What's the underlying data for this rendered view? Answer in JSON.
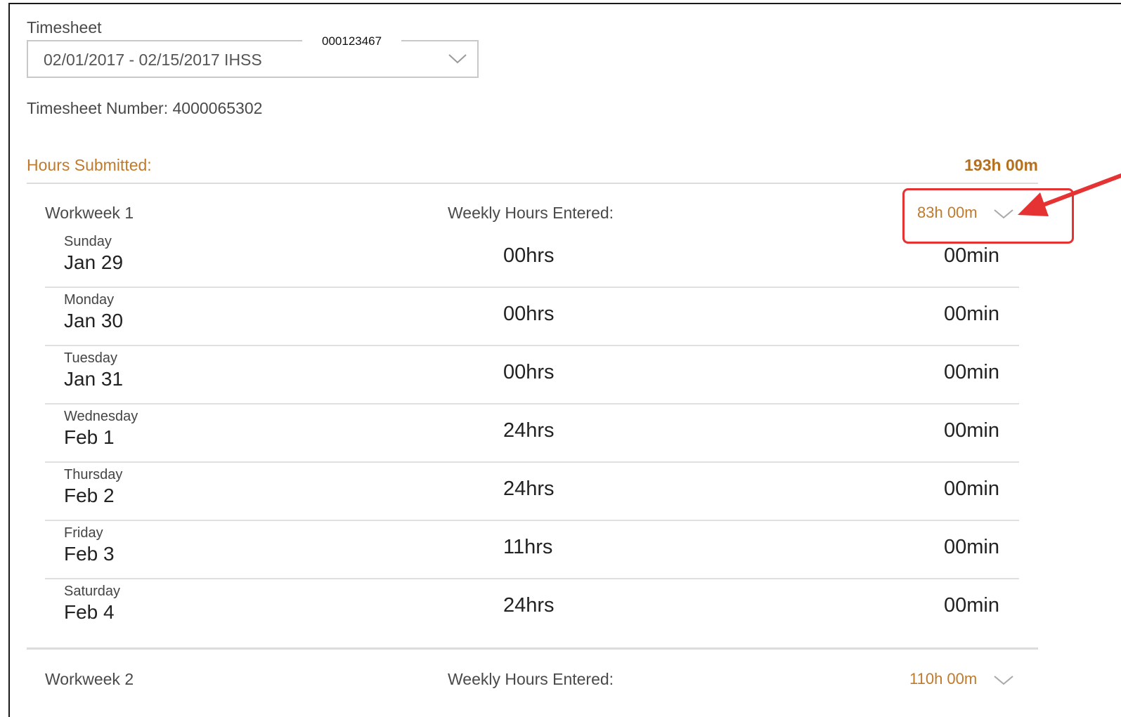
{
  "timesheet": {
    "label": "Timesheet",
    "selected": "02/01/2017 - 02/15/2017 IHSS",
    "id_tag": "000123467",
    "number_text": "Timesheet Number: 4000065302"
  },
  "hours_submitted": {
    "label": "Hours Submitted:",
    "value": "193h 00m"
  },
  "workweek1": {
    "label": "Workweek 1",
    "weekly_label": "Weekly Hours Entered:",
    "total": "83h 00m",
    "days": [
      {
        "day": "Sunday",
        "date": "Jan 29",
        "hrs": "00hrs",
        "min": "00min"
      },
      {
        "day": "Monday",
        "date": "Jan 30",
        "hrs": "00hrs",
        "min": "00min"
      },
      {
        "day": "Tuesday",
        "date": "Jan 31",
        "hrs": "00hrs",
        "min": "00min"
      },
      {
        "day": "Wednesday",
        "date": "Feb 1",
        "hrs": "24hrs",
        "min": "00min"
      },
      {
        "day": "Thursday",
        "date": "Feb 2",
        "hrs": "24hrs",
        "min": "00min"
      },
      {
        "day": "Friday",
        "date": "Feb 3",
        "hrs": "11hrs",
        "min": "00min"
      },
      {
        "day": "Saturday",
        "date": "Feb 4",
        "hrs": "24hrs",
        "min": "00min"
      }
    ]
  },
  "workweek2": {
    "label": "Workweek 2",
    "weekly_label": "Weekly Hours Entered:",
    "total": "110h 00m"
  },
  "colors": {
    "accent": "#c07a2c",
    "annotation": "#e53232"
  },
  "icons": {
    "dropdown": "chevron-down-icon",
    "annotation": "arrow-icon"
  }
}
